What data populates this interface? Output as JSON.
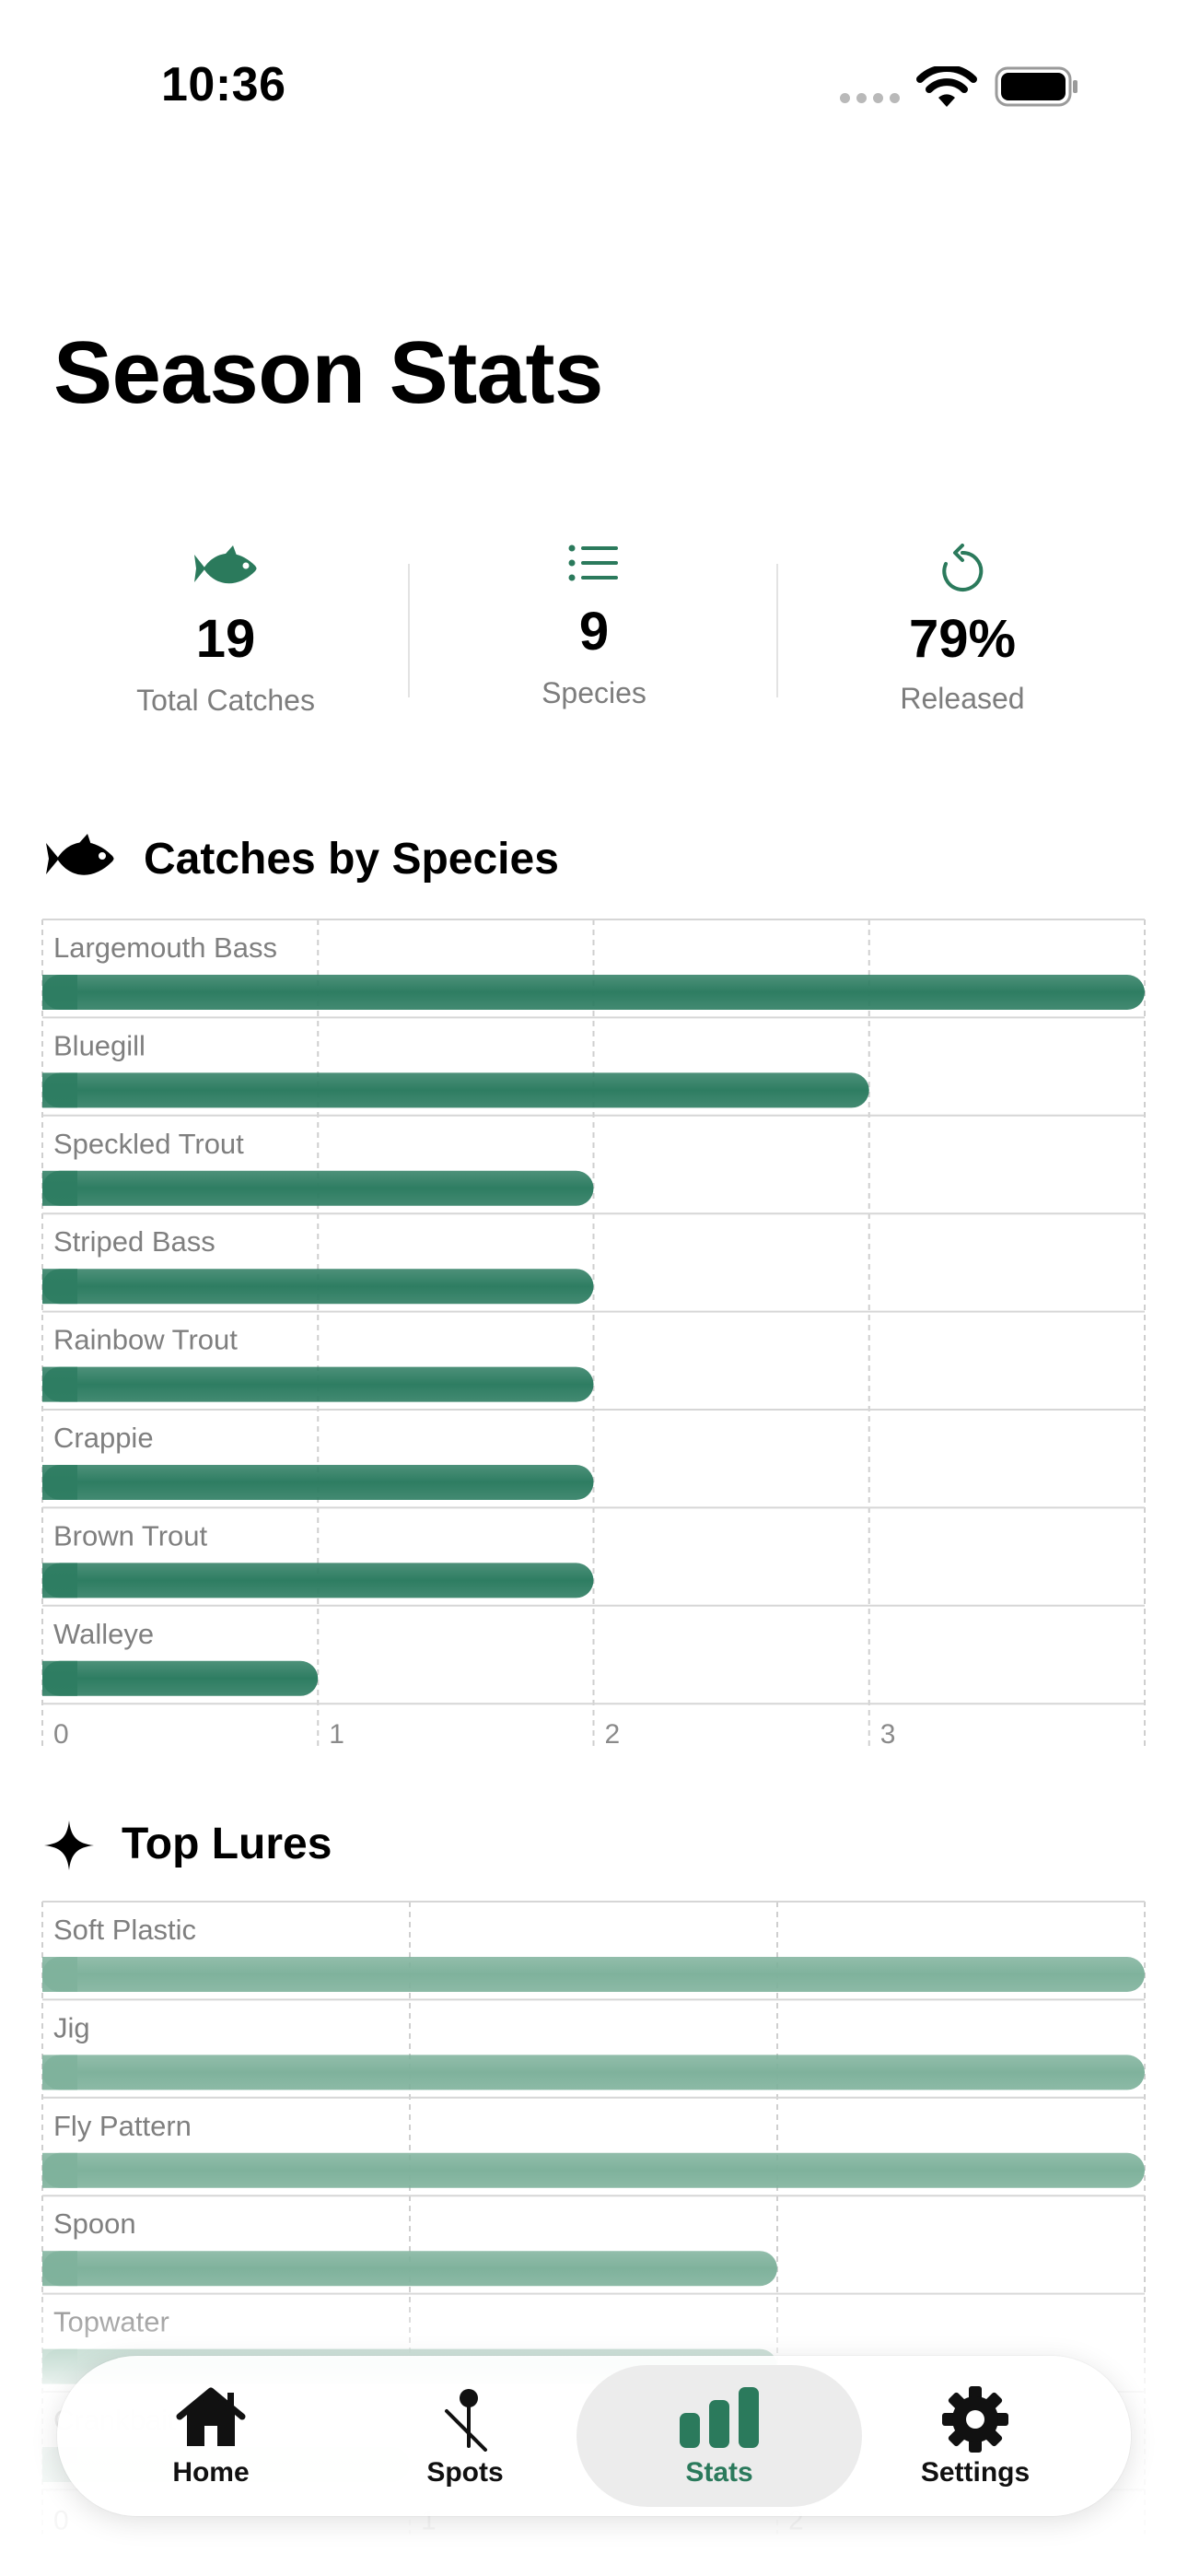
{
  "status_bar": {
    "time": "10:36",
    "icons": [
      "signal-dots-icon",
      "wifi-icon",
      "battery-icon"
    ]
  },
  "page": {
    "title": "Season Stats"
  },
  "summary": {
    "items": [
      {
        "icon": "fish-icon",
        "value": "19",
        "label": "Total Catches"
      },
      {
        "icon": "list-icon",
        "value": "9",
        "label": "Species"
      },
      {
        "icon": "refresh-icon",
        "value": "79%",
        "label": "Released"
      }
    ]
  },
  "sections": {
    "species": {
      "icon": "fish-icon",
      "title": "Catches by Species"
    },
    "lures": {
      "icon": "sparkle-icon",
      "title": "Top Lures"
    }
  },
  "colors": {
    "accent": "#2b7a5c",
    "bar_species": "#2e7d62",
    "bar_lures": "#7fb29c",
    "tab_active_bg": "#ececec"
  },
  "chart_data": [
    {
      "type": "bar",
      "orientation": "horizontal",
      "categories": [
        "Largemouth Bass",
        "Bluegill",
        "Speckled Trout",
        "Striped Bass",
        "Rainbow Trout",
        "Crappie",
        "Brown Trout",
        "Walleye"
      ],
      "values": [
        4,
        3,
        2,
        2,
        2,
        2,
        2,
        1
      ],
      "x_ticks": [
        "0",
        "1",
        "2",
        "3"
      ],
      "xlim": [
        0,
        4
      ],
      "grid": true
    },
    {
      "type": "bar",
      "orientation": "horizontal",
      "categories": [
        "Soft Plastic",
        "Jig",
        "Fly Pattern",
        "Spoon",
        "Topwater",
        "Crankbait"
      ],
      "values": [
        3,
        3,
        3,
        2,
        2,
        1
      ],
      "x_ticks": [
        "0",
        "1",
        "2"
      ],
      "xlim": [
        0,
        3
      ],
      "grid": true
    }
  ],
  "tab_bar": {
    "tabs": [
      {
        "icon": "house-icon",
        "label": "Home",
        "active": false
      },
      {
        "icon": "pin-icon",
        "label": "Spots",
        "active": false
      },
      {
        "icon": "chart-bar-icon",
        "label": "Stats",
        "active": true
      },
      {
        "icon": "gear-icon",
        "label": "Settings",
        "active": false
      }
    ]
  }
}
